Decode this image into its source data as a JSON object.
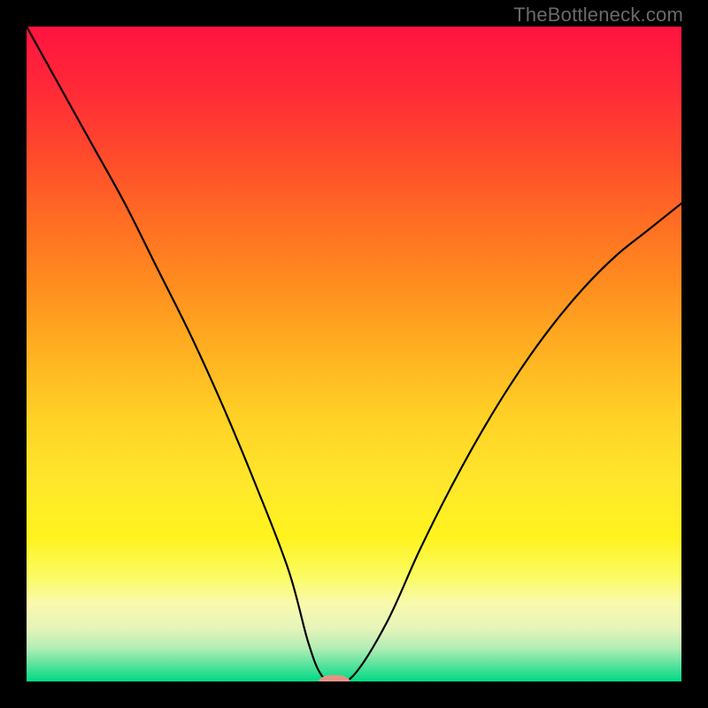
{
  "attribution": "TheBottleneck.com",
  "chart_data": {
    "type": "line",
    "title": "",
    "xlabel": "",
    "ylabel": "",
    "xlim": [
      0,
      100
    ],
    "ylim": [
      0,
      100
    ],
    "grid": false,
    "legend": false,
    "series": [
      {
        "name": "bottleneck-curve",
        "x": [
          0,
          5,
          10,
          15,
          20,
          25,
          30,
          35,
          40,
          43,
          45,
          47,
          50,
          55,
          60,
          65,
          70,
          75,
          80,
          85,
          90,
          95,
          100
        ],
        "y": [
          100,
          91,
          82,
          73,
          63,
          53,
          42,
          30,
          17,
          6,
          1,
          0,
          1,
          9,
          20,
          30,
          39,
          47,
          54,
          60,
          65,
          69,
          73
        ]
      }
    ],
    "marker": {
      "x": 47,
      "y": 0,
      "rx": 2.4,
      "ry": 1.0,
      "color": "#e69385"
    },
    "background_gradient": {
      "stops": [
        {
          "offset": 0.0,
          "color": "#ff1340"
        },
        {
          "offset": 0.1,
          "color": "#ff2b37"
        },
        {
          "offset": 0.2,
          "color": "#ff4b2b"
        },
        {
          "offset": 0.3,
          "color": "#ff6e23"
        },
        {
          "offset": 0.4,
          "color": "#ff8f1f"
        },
        {
          "offset": 0.5,
          "color": "#ffb221"
        },
        {
          "offset": 0.6,
          "color": "#ffd226"
        },
        {
          "offset": 0.7,
          "color": "#ffe82b"
        },
        {
          "offset": 0.78,
          "color": "#fff31e"
        },
        {
          "offset": 0.84,
          "color": "#fbfb63"
        },
        {
          "offset": 0.88,
          "color": "#f9faac"
        },
        {
          "offset": 0.92,
          "color": "#e4f4ba"
        },
        {
          "offset": 0.95,
          "color": "#b0edb4"
        },
        {
          "offset": 0.975,
          "color": "#57e39c"
        },
        {
          "offset": 1.0,
          "color": "#00da84"
        }
      ]
    }
  }
}
